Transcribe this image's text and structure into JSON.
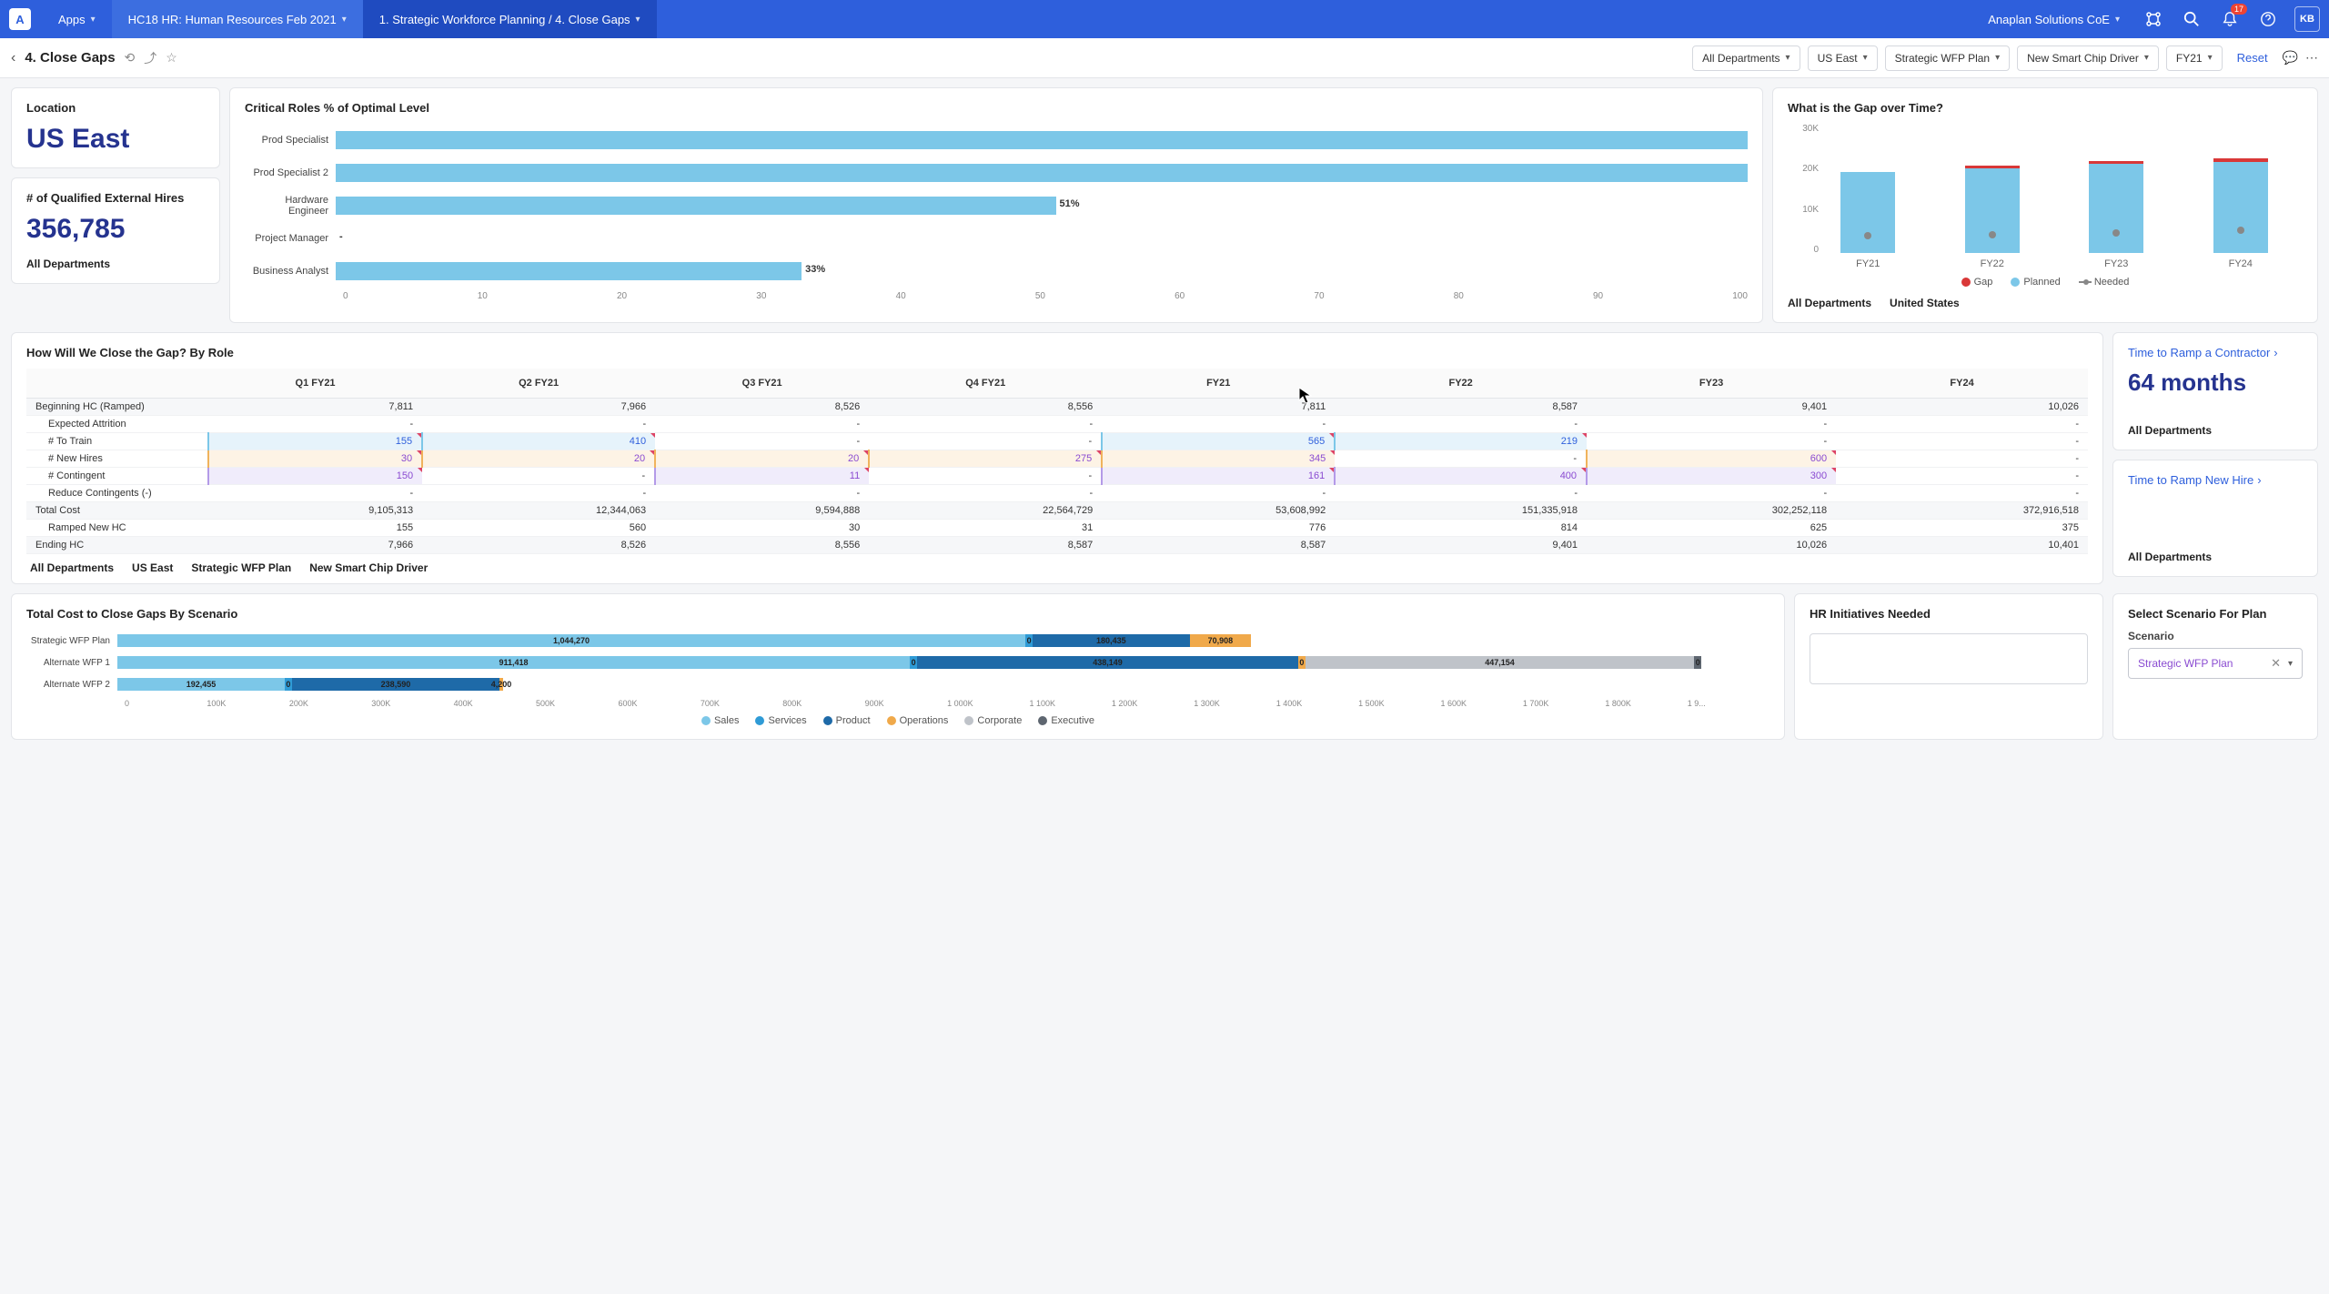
{
  "nav": {
    "apps": "Apps",
    "model": "HC18 HR: Human Resources Feb 2021",
    "breadcrumb": "1. Strategic Workforce Planning / 4. Close Gaps",
    "workspace": "Anaplan Solutions CoE",
    "notif_count": "17",
    "avatar": "KB"
  },
  "header": {
    "title": "4. Close Gaps",
    "filters": {
      "dept": "All Departments",
      "region": "US East",
      "plan": "Strategic WFP Plan",
      "driver": "New Smart Chip Driver",
      "year": "FY21"
    },
    "reset": "Reset"
  },
  "location": {
    "title": "Location",
    "value": "US East"
  },
  "hires": {
    "title": "# of Qualified External Hires",
    "value": "356,785",
    "sub": "All Departments"
  },
  "critical": {
    "title": "Critical Roles % of Optimal Level",
    "roles": [
      {
        "name": "Prod Specialist",
        "pct": 100,
        "label": ""
      },
      {
        "name": "Prod Specialist 2",
        "pct": 100,
        "label": ""
      },
      {
        "name": "Hardware Engineer",
        "pct": 51,
        "label": "51%"
      },
      {
        "name": "Project Manager",
        "pct": 0,
        "label": "-"
      },
      {
        "name": "Business Analyst",
        "pct": 33,
        "label": "33%"
      }
    ],
    "axis": [
      "0",
      "10",
      "20",
      "30",
      "40",
      "50",
      "60",
      "70",
      "80",
      "90",
      "100"
    ]
  },
  "gapTime": {
    "title": "What is the Gap over Time?",
    "ylabels": [
      "30K",
      "20K",
      "10K",
      "0"
    ],
    "bars": [
      {
        "x": "FY21",
        "planned": 19000,
        "gap": 0,
        "needed": 5000
      },
      {
        "x": "FY22",
        "planned": 20000,
        "gap": 600,
        "needed": 5200
      },
      {
        "x": "FY23",
        "planned": 21000,
        "gap": 700,
        "needed": 5500
      },
      {
        "x": "FY24",
        "planned": 21500,
        "gap": 800,
        "needed": 6200
      }
    ],
    "legend": {
      "gap": "Gap",
      "planned": "Planned",
      "needed": "Needed"
    },
    "ctx1": "All Departments",
    "ctx2": "United States"
  },
  "gapTable": {
    "title": "How Will We Close the Gap? By Role",
    "cols": [
      "Q1 FY21",
      "Q2 FY21",
      "Q3 FY21",
      "Q4 FY21",
      "FY21",
      "FY22",
      "FY23",
      "FY24"
    ],
    "rows": [
      {
        "l": "Beginning HC (Ramped)",
        "cls": "shade",
        "v": [
          "7,811",
          "7,966",
          "8,526",
          "8,556",
          "7,811",
          "8,587",
          "9,401",
          "10,026"
        ]
      },
      {
        "l": "Expected Attrition",
        "cls": "indent",
        "v": [
          "-",
          "-",
          "-",
          "-",
          "-",
          "-",
          "-",
          "-"
        ]
      },
      {
        "l": "# To Train",
        "cls": "indent edit-blue",
        "v": [
          "155",
          "410",
          "-",
          "-",
          "565",
          "219",
          "-",
          "-"
        ]
      },
      {
        "l": "# New Hires",
        "cls": "indent edit-orange",
        "v": [
          "30",
          "20",
          "20",
          "275",
          "345",
          "-",
          "600",
          "-"
        ]
      },
      {
        "l": "# Contingent",
        "cls": "indent edit-purple",
        "v": [
          "150",
          "-",
          "11",
          "-",
          "161",
          "400",
          "300",
          "-"
        ]
      },
      {
        "l": "Reduce Contingents (-)",
        "cls": "indent",
        "v": [
          "-",
          "-",
          "-",
          "-",
          "-",
          "-",
          "-",
          "-"
        ]
      },
      {
        "l": "Total Cost",
        "cls": "shade",
        "v": [
          "9,105,313",
          "12,344,063",
          "9,594,888",
          "22,564,729",
          "53,608,992",
          "151,335,918",
          "302,252,118",
          "372,916,518"
        ]
      },
      {
        "l": "Ramped New HC",
        "cls": "indent",
        "v": [
          "155",
          "560",
          "30",
          "31",
          "776",
          "814",
          "625",
          "375"
        ]
      },
      {
        "l": "Ending HC",
        "cls": "shade",
        "v": [
          "7,966",
          "8,526",
          "8,556",
          "8,587",
          "8,587",
          "9,401",
          "10,026",
          "10,401"
        ]
      }
    ],
    "ctx": [
      "All Departments",
      "US East",
      "Strategic WFP Plan",
      "New Smart Chip Driver"
    ]
  },
  "rampContractor": {
    "title": "Time to Ramp a Contractor",
    "value": "64 months",
    "sub": "All Departments"
  },
  "rampHire": {
    "title": "Time to Ramp New Hire",
    "sub": "All Departments"
  },
  "totalCost": {
    "title": "Total Cost to Close Gaps By Scenario",
    "max": 1900000,
    "scenarios": [
      {
        "name": "Strategic WFP Plan",
        "segs": [
          {
            "c": "#7cc7e8",
            "v": 1044270,
            "t": "1,044,270"
          },
          {
            "c": "#2f9bd6",
            "v": 0,
            "t": "0"
          },
          {
            "c": "#1e6aa8",
            "v": 180435,
            "t": "180,435"
          },
          {
            "c": "#f0a94a",
            "v": 70908,
            "t": "70,908"
          }
        ]
      },
      {
        "name": "Alternate WFP 1",
        "segs": [
          {
            "c": "#7cc7e8",
            "v": 911418,
            "t": "911,418"
          },
          {
            "c": "#2f9bd6",
            "v": 0,
            "t": "0"
          },
          {
            "c": "#1e6aa8",
            "v": 438149,
            "t": "438,149"
          },
          {
            "c": "#f0a94a",
            "v": 0,
            "t": "0"
          },
          {
            "c": "#bfc3c9",
            "v": 447154,
            "t": "447,154"
          },
          {
            "c": "#5e6670",
            "v": 0,
            "t": "0"
          }
        ]
      },
      {
        "name": "Alternate WFP 2",
        "segs": [
          {
            "c": "#7cc7e8",
            "v": 192455,
            "t": "192,455"
          },
          {
            "c": "#2f9bd6",
            "v": 0,
            "t": "0"
          },
          {
            "c": "#1e6aa8",
            "v": 238590,
            "t": "238,590"
          },
          {
            "c": "#f0a94a",
            "v": 4200,
            "t": "4,200"
          }
        ]
      }
    ],
    "axis": [
      "0",
      "100K",
      "200K",
      "300K",
      "400K",
      "500K",
      "600K",
      "700K",
      "800K",
      "900K",
      "1 000K",
      "1 100K",
      "1 200K",
      "1 300K",
      "1 400K",
      "1 500K",
      "1 600K",
      "1 700K",
      "1 800K",
      "1 9..."
    ],
    "legend": [
      {
        "c": "#7cc7e8",
        "t": "Sales"
      },
      {
        "c": "#2f9bd6",
        "t": "Services"
      },
      {
        "c": "#1e6aa8",
        "t": "Product"
      },
      {
        "c": "#f0a94a",
        "t": "Operations"
      },
      {
        "c": "#bfc3c9",
        "t": "Corporate"
      },
      {
        "c": "#5e6670",
        "t": "Executive"
      }
    ]
  },
  "hrInit": {
    "title": "HR Initiatives Needed"
  },
  "scenario": {
    "title": "Select Scenario For Plan",
    "label": "Scenario",
    "value": "Strategic WFP Plan"
  },
  "chart_data": [
    {
      "type": "bar",
      "orientation": "horizontal",
      "title": "Critical Roles % of Optimal Level",
      "categories": [
        "Prod Specialist",
        "Prod Specialist 2",
        "Hardware Engineer",
        "Project Manager",
        "Business Analyst"
      ],
      "values": [
        100,
        100,
        51,
        0,
        33
      ],
      "xlim": [
        0,
        100
      ]
    },
    {
      "type": "bar",
      "stacked": true,
      "title": "What is the Gap over Time?",
      "categories": [
        "FY21",
        "FY22",
        "FY23",
        "FY24"
      ],
      "series": [
        {
          "name": "Planned",
          "values": [
            19000,
            20000,
            21000,
            21500
          ]
        },
        {
          "name": "Gap",
          "values": [
            0,
            600,
            700,
            800
          ]
        },
        {
          "name": "Needed",
          "type": "line",
          "values": [
            5000,
            5200,
            5500,
            6200
          ]
        }
      ],
      "ylim": [
        0,
        30000
      ]
    },
    {
      "type": "bar",
      "stacked": true,
      "orientation": "horizontal",
      "title": "Total Cost to Close Gaps By Scenario",
      "categories": [
        "Strategic WFP Plan",
        "Alternate WFP 1",
        "Alternate WFP 2"
      ],
      "series": [
        {
          "name": "Sales",
          "values": [
            1044270,
            911418,
            192455
          ]
        },
        {
          "name": "Services",
          "values": [
            0,
            0,
            0
          ]
        },
        {
          "name": "Product",
          "values": [
            180435,
            438149,
            238590
          ]
        },
        {
          "name": "Operations",
          "values": [
            70908,
            0,
            4200
          ]
        },
        {
          "name": "Corporate",
          "values": [
            0,
            447154,
            0
          ]
        },
        {
          "name": "Executive",
          "values": [
            0,
            0,
            0
          ]
        }
      ],
      "xlim": [
        0,
        1900000
      ]
    }
  ]
}
